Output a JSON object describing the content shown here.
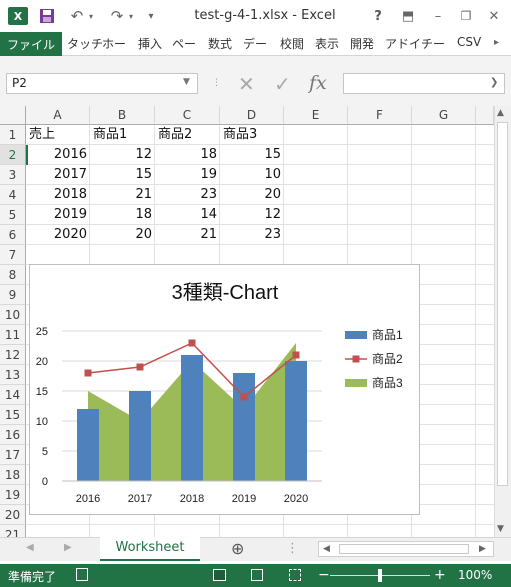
{
  "window": {
    "title": "test-g-4-1.xlsx - Excel",
    "help": "?",
    "minimize": "–",
    "restore": "❐",
    "close": "✕"
  },
  "quick_access": {
    "logo": "X",
    "undo": "↶",
    "redo": "↷",
    "more": "▾"
  },
  "ribbon": {
    "file_tab": "ファイル",
    "tabs": [
      "タッチ",
      "ホー",
      "挿入",
      "ペー",
      "数式",
      "デー",
      "校閲",
      "表示",
      "開発",
      "アドイ",
      "チー",
      "CSV"
    ]
  },
  "formula_bar": {
    "name_box": "P2",
    "cancel": "✕",
    "enter": "✓",
    "fx": "fx",
    "value": ""
  },
  "sheet": {
    "columns": [
      "A",
      "B",
      "C",
      "D",
      "E",
      "F",
      "G"
    ],
    "rows": [
      "1",
      "2",
      "3",
      "4",
      "5",
      "6",
      "7",
      "8",
      "9",
      "10",
      "11",
      "12",
      "13",
      "14",
      "15",
      "16",
      "17",
      "18",
      "19",
      "20",
      "21"
    ],
    "header": [
      "売上",
      "商品1",
      "商品2",
      "商品3"
    ],
    "data": [
      [
        "2016",
        "12",
        "18",
        "15"
      ],
      [
        "2017",
        "15",
        "19",
        "10"
      ],
      [
        "2018",
        "21",
        "23",
        "20"
      ],
      [
        "2019",
        "18",
        "14",
        "12"
      ],
      [
        "2020",
        "20",
        "21",
        "23"
      ]
    ]
  },
  "colors": {
    "accent": "#217346",
    "series1": "#4f81bd",
    "series2": "#c0504d",
    "series3": "#9bbb59"
  },
  "chart_data": {
    "type": "bar",
    "title": "3種類-Chart",
    "categories": [
      "2016",
      "2017",
      "2018",
      "2019",
      "2020"
    ],
    "series": [
      {
        "name": "商品1",
        "type": "bar",
        "values": [
          12,
          15,
          21,
          18,
          20
        ]
      },
      {
        "name": "商品2",
        "type": "line",
        "values": [
          18,
          19,
          23,
          14,
          21
        ]
      },
      {
        "name": "商品3",
        "type": "area",
        "values": [
          15,
          10,
          20,
          12,
          23
        ]
      }
    ],
    "ylim": [
      0,
      25
    ],
    "yticks": [
      "0",
      "5",
      "10",
      "15",
      "20",
      "25"
    ],
    "grid": true,
    "legend": "right"
  },
  "sheet_tabs": {
    "active": "Worksheet",
    "add": "⊕"
  },
  "status": {
    "ready": "準備完了",
    "zoom": "100%",
    "zoom_minus": "−",
    "zoom_plus": "+"
  }
}
